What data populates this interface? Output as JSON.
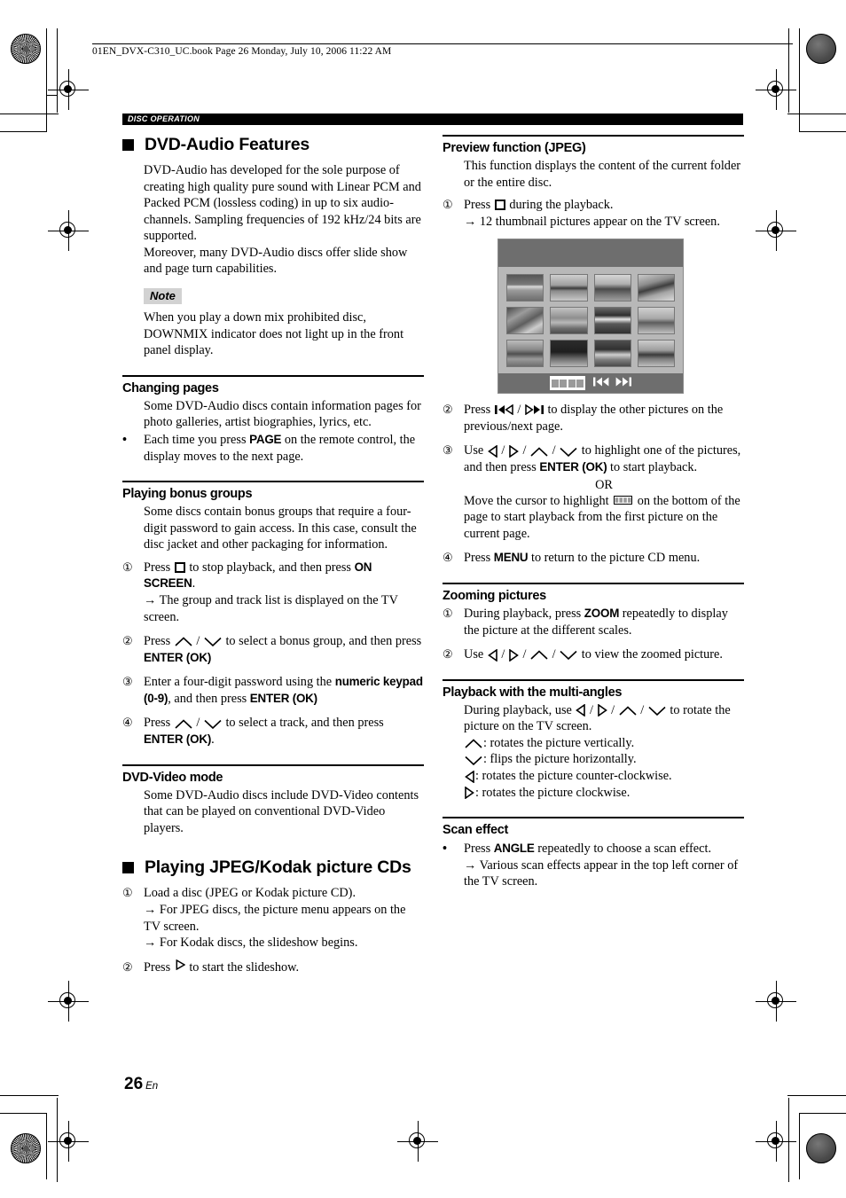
{
  "header": {
    "file_line": "01EN_DVX-C310_UC.book  Page 26  Monday, July 10, 2006  11:22 AM",
    "running_head": "DISC OPERATION"
  },
  "footer": {
    "page_number": "26",
    "language": "En"
  },
  "left_column": {
    "major_heading": "DVD-Audio Features",
    "intro_paragraph_1": "DVD-Audio has developed for the sole purpose of creating high quality pure sound with Linear PCM and Packed PCM (lossless coding) in up to six audio-channels. Sampling frequencies of 192 kHz/24 bits are supported.",
    "intro_paragraph_2": "Moreover, many DVD-Audio discs offer slide show and page turn capabilities.",
    "note": {
      "label": "Note",
      "text": "When you play a down mix prohibited disc, DOWNMIX indicator does not light up in the front panel display."
    },
    "changing_pages": {
      "heading": "Changing pages",
      "paragraph": "Some DVD-Audio discs contain information pages for photo galleries, artist biographies, lyrics, etc.",
      "bullet_marker": "•",
      "bullet_pre": "Each time you press ",
      "bullet_bold": "PAGE",
      "bullet_post": " on the remote control, the display moves to the next page."
    },
    "bonus_groups": {
      "heading": "Playing bonus groups",
      "paragraph": "Some discs contain bonus groups that require a four-digit password to gain access. In this case, consult the disc jacket and other packaging for information.",
      "step1": {
        "marker": "①",
        "pre": "Press ",
        "mid": " to stop playback, and then press ",
        "bold": "ON SCREEN",
        "post": ".",
        "arrow_note": "→ The group and track list is displayed on the TV screen."
      },
      "step2": {
        "marker": "②",
        "pre": "Press ",
        "mid": " to select a bonus group, and then press ",
        "bold": "ENTER (OK)"
      },
      "step3": {
        "marker": "③",
        "pre": "Enter a four-digit password using the ",
        "bold1": "numeric keypad (0-9)",
        "mid": ", and then press ",
        "bold2": "ENTER (OK)"
      },
      "step4": {
        "marker": "④",
        "pre": "Press ",
        "mid": " to select a track, and then press ",
        "bold": "ENTER (OK)",
        "post": "."
      }
    },
    "dvd_video_mode": {
      "heading": "DVD-Video mode",
      "paragraph": "Some DVD-Audio discs include DVD-Video contents that can be played on conventional DVD-Video players."
    },
    "jpeg_kodak": {
      "major_heading": "Playing JPEG/Kodak picture CDs",
      "step1": {
        "marker": "①",
        "text": "Load a disc (JPEG or Kodak picture CD).",
        "arrow_note_1": "→ For JPEG discs, the picture menu appears on the TV screen.",
        "arrow_note_2": "→ For Kodak discs, the slideshow begins."
      },
      "step2": {
        "marker": "②",
        "pre": "Press ",
        "post": " to start the slideshow."
      }
    }
  },
  "right_column": {
    "preview": {
      "heading": "Preview function (JPEG)",
      "paragraph": "This function displays the content of the current folder or the entire disc.",
      "step1": {
        "marker": "①",
        "pre": "Press ",
        "post": " during the playback.",
        "arrow_note": "→ 12 thumbnail pictures appear on the TV screen."
      },
      "step2": {
        "marker": "②",
        "pre": "Press ",
        "sep": " / ",
        "post": " to display the other pictures on the previous/next page."
      },
      "step3": {
        "marker": "③",
        "pre": "Use ",
        "mid": " to highlight one of the pictures, and then press ",
        "bold": "ENTER (OK)",
        "post": " to start playback."
      },
      "or_label": "OR",
      "or_text_pre": "Move the cursor to highlight ",
      "or_text_post": " on the bottom of the page to start playback from the first picture on the current page.",
      "step4": {
        "marker": "④",
        "pre": "Press ",
        "bold": "MENU",
        "post": " to return to the picture CD menu."
      },
      "tv_mock": {
        "thumbnail_count": 12,
        "filmstrip_frames": 4,
        "skip_prev_icon": "skip-previous-icon",
        "skip_next_icon": "skip-next-icon"
      }
    },
    "zooming": {
      "heading": "Zooming pictures",
      "step1": {
        "marker": "①",
        "pre": "During playback, press ",
        "bold": "ZOOM",
        "post": " repeatedly to display the picture at the different scales."
      },
      "step2": {
        "marker": "②",
        "pre": "Use ",
        "post": " to view the zoomed picture."
      }
    },
    "multi_angles": {
      "heading": "Playback with the multi-angles",
      "pre": "During playback, use ",
      "post": " to rotate the picture on the TV screen.",
      "legend": [
        {
          "icon": "triangle-up-icon",
          "text": ": rotates the picture vertically."
        },
        {
          "icon": "triangle-down-icon",
          "text": ": flips the picture horizontally."
        },
        {
          "icon": "triangle-left-icon",
          "text": ": rotates the picture counter-clockwise."
        },
        {
          "icon": "triangle-right-icon",
          "text": ": rotates the picture clockwise."
        }
      ]
    },
    "scan_effect": {
      "heading": "Scan effect",
      "bullet_marker": "•",
      "pre": "Press ",
      "bold": "ANGLE",
      "post": " repeatedly to choose a scan effect.",
      "arrow_note": "→ Various scan effects appear in the top left corner of the TV screen."
    }
  }
}
